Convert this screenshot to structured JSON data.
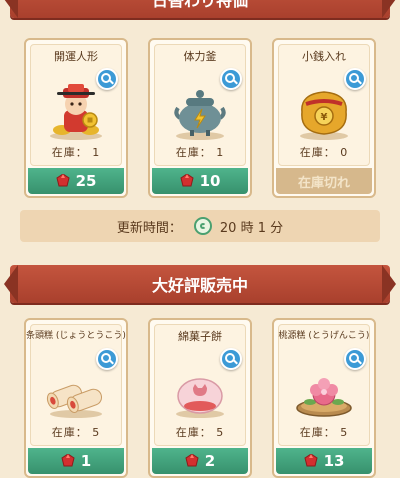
{
  "daily_section": {
    "title": "日替わり特価",
    "items": [
      {
        "name": "開運人形",
        "stock": "在庫： 1",
        "price": "25"
      },
      {
        "name": "体力釜",
        "stock": "在庫： 1",
        "price": "10"
      },
      {
        "name": "小銭入れ",
        "stock": "在庫： 0",
        "price": "在庫切れ"
      }
    ]
  },
  "refresh": {
    "label": "更新時間：",
    "time": "20 時 1 分"
  },
  "sale_section": {
    "title": "大好評販売中",
    "items": [
      {
        "name": "条頭糕 (じょうとうこう)",
        "stock": "在庫： 5",
        "price": "1"
      },
      {
        "name": "綿菓子餅",
        "stock": "在庫： 5",
        "price": "2"
      },
      {
        "name": "桃源糕 (とうげんこう)",
        "stock": "在庫： 5",
        "price": "13"
      }
    ]
  },
  "colors": {
    "price_green": "#37916d",
    "banner_red": "#a9402d",
    "gem_red": "#d32f2f"
  }
}
